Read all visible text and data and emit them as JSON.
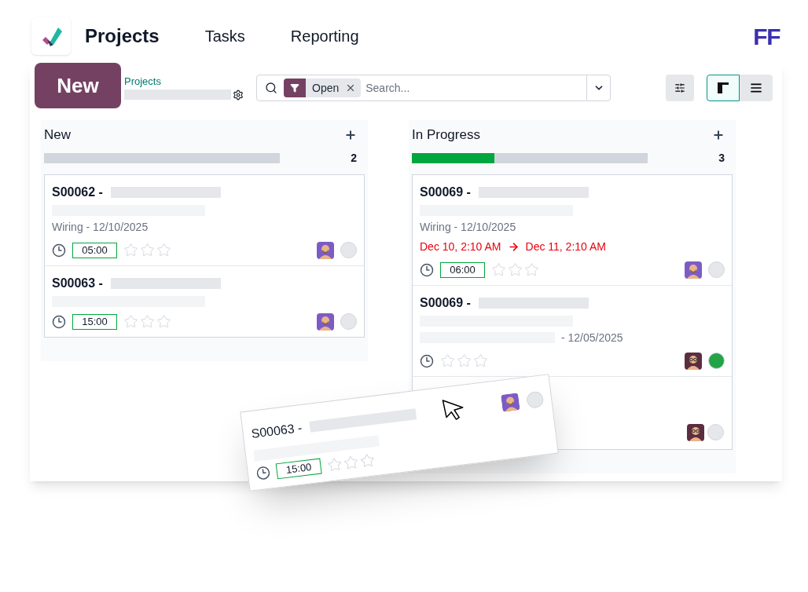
{
  "app_menu": {
    "title": "Projects",
    "items": [
      {
        "label": "Tasks"
      },
      {
        "label": "Reporting"
      }
    ],
    "brand": "FF"
  },
  "control_panel": {
    "new_button": "New",
    "breadcrumb": "Projects",
    "search": {
      "facet": "Open",
      "placeholder": "Search..."
    },
    "views": [
      {
        "kind": "kanban",
        "selected": true
      },
      {
        "kind": "list",
        "selected": false
      }
    ]
  },
  "columns": [
    {
      "title": "New",
      "count": "2",
      "cards": [
        {
          "kind": "full",
          "title": "S00062 -",
          "lines": [
            {
              "kind": "redacted"
            },
            {
              "kind": "text",
              "text": "Wiring - 12/10/2025"
            }
          ],
          "timer": "05:00",
          "stars": 0,
          "avatar": {
            "kind": "beard"
          },
          "status": {
            "color": "#e5e7eb"
          }
        },
        {
          "kind": "full",
          "title": "S00063 -",
          "lines": [
            {
              "kind": "redacted"
            }
          ],
          "timer": "15:00",
          "stars": 0,
          "avatar": {
            "kind": "beard"
          },
          "status": {
            "color": "#e5e7eb"
          }
        }
      ]
    },
    {
      "title": "In Progress",
      "count": "3",
      "level": 0.35,
      "cards": [
        {
          "kind": "full",
          "title": "S00069 -",
          "lines": [
            {
              "kind": "redacted"
            },
            {
              "kind": "text",
              "text": "Wiring - 12/10/2025"
            }
          ],
          "dates": {
            "start": "Dec 10, 2:10 AM",
            "end": "Dec 11, 2:10 AM"
          },
          "timer": "06:00",
          "stars": 0,
          "avatar": {
            "kind": "beard"
          },
          "status": {
            "color": "#e5e7eb"
          }
        },
        {
          "kind": "full",
          "title": "S00069 -",
          "lines": [
            {
              "kind": "redacted"
            },
            {
              "kind": "redacted_text",
              "text": "- 12/05/2025"
            }
          ],
          "stars": 0,
          "avatar": {
            "kind": "glasses"
          },
          "status": {
            "color": "#22a447"
          }
        },
        {
          "kind": "covered",
          "avatar": {
            "kind": "glasses"
          },
          "status": {
            "color": "#e5e7eb"
          }
        }
      ]
    }
  ],
  "dragged_card": {
    "title": "S00063 -",
    "timer": "15:00",
    "stars": 0,
    "avatar": {
      "kind": "beard"
    },
    "status": {
      "color": "#e5e7eb"
    }
  }
}
